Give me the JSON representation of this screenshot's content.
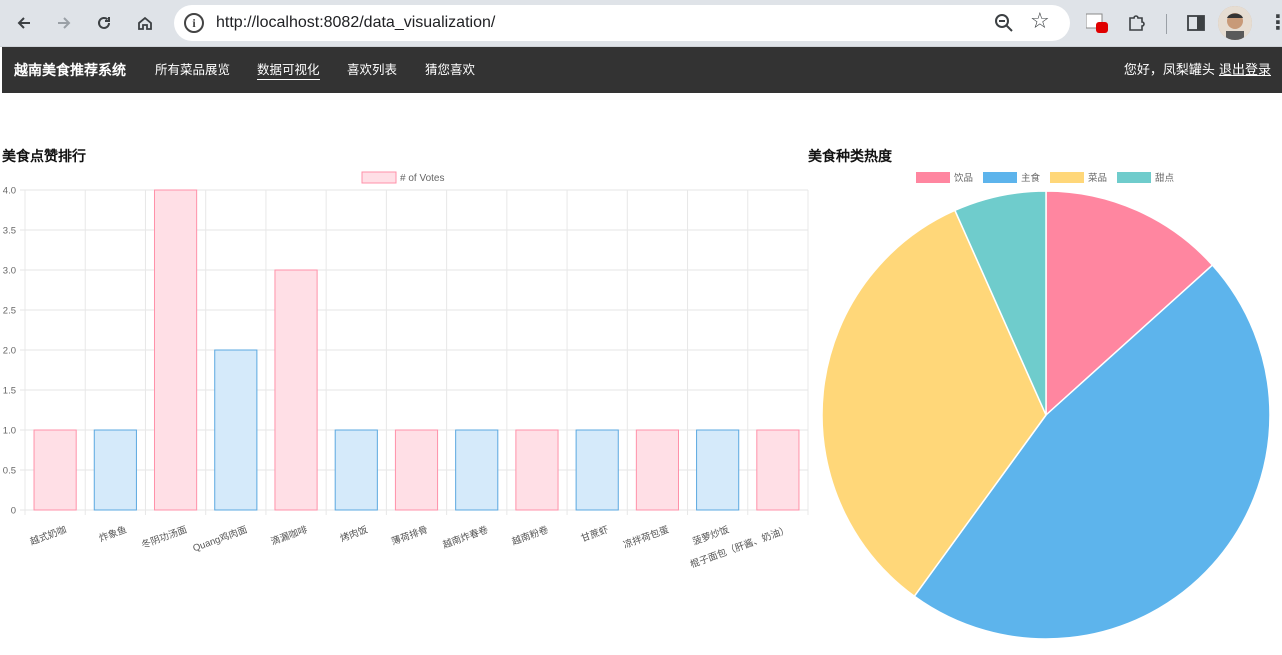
{
  "browser": {
    "url_prefix": "http://",
    "url_host": "localhost",
    "url_rest": ":8082/data_visualization/"
  },
  "navbar": {
    "brand": "越南美食推荐系统",
    "links": [
      {
        "label": "所有菜品展览",
        "active": false
      },
      {
        "label": "数据可视化",
        "active": true
      },
      {
        "label": "喜欢列表",
        "active": false
      },
      {
        "label": "猜您喜欢",
        "active": false
      }
    ],
    "greeting": "您好，凤梨罐头",
    "logout": "退出登录"
  },
  "bar_section": {
    "title": "美食点赞排行"
  },
  "pie_section": {
    "title": "美食种类热度"
  },
  "colors": {
    "pink_fill": "#ffdfe6",
    "pink_border": "#ff91a9",
    "blue_fill": "#d5eafa",
    "blue_border": "#5ba8e0",
    "pie_pink": "#ff86a0",
    "pie_blue": "#5db4ec",
    "pie_yellow": "#ffd779",
    "pie_teal": "#6fcccc"
  },
  "chart_data": [
    {
      "type": "bar",
      "legend": "# of Votes",
      "categories": [
        "越式奶咖",
        "炸象鱼",
        "冬阴功汤面",
        "Quang鸡肉面",
        "滴漏咖啡",
        "烤肉饭",
        "薄荷排骨",
        "越南炸春卷",
        "越南粉卷",
        "甘蔗虾",
        "凉拌荷包蛋",
        "菠萝炒饭",
        "棍子面包（肝酱、奶油）"
      ],
      "values": [
        1,
        1,
        4,
        2,
        3,
        1,
        1,
        1,
        1,
        1,
        1,
        1,
        1
      ],
      "ylim": [
        0,
        4
      ],
      "yticks": [
        "0",
        "0.5",
        "1.0",
        "1.5",
        "2.0",
        "2.5",
        "3.0",
        "3.5",
        "4.0"
      ],
      "grid": true,
      "legend_position": "top"
    },
    {
      "type": "pie",
      "labels": [
        "饮品",
        "主食",
        "菜品",
        "甜点"
      ],
      "values": [
        2,
        7,
        5,
        1
      ],
      "legend_position": "top"
    }
  ]
}
